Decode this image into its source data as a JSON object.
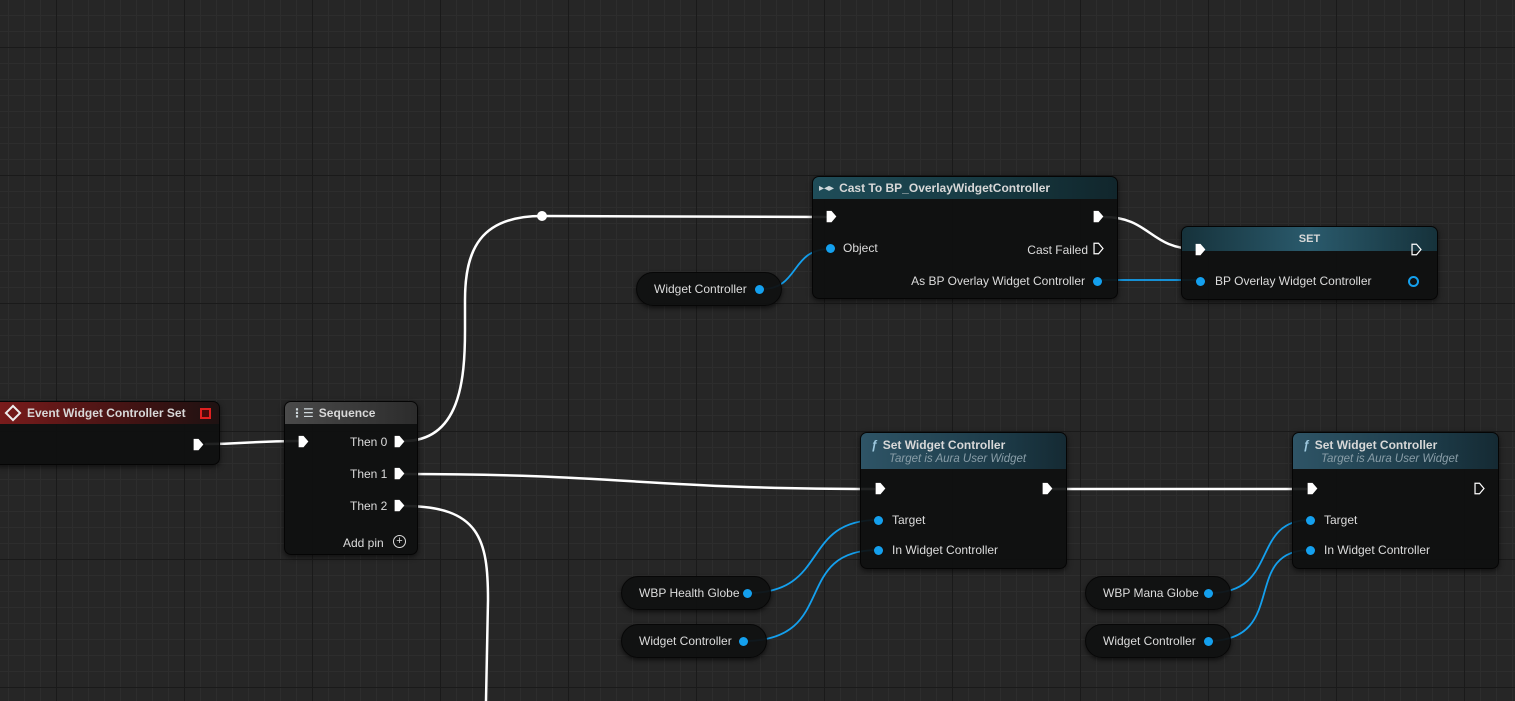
{
  "nodes": {
    "event": {
      "title": "Event Widget Controller Set"
    },
    "sequence": {
      "title": "Sequence",
      "then0": "Then 0",
      "then1": "Then 1",
      "then2": "Then 2",
      "add_pin": "Add pin"
    },
    "cast": {
      "title": "Cast To BP_OverlayWidgetController",
      "object": "Object",
      "cast_failed": "Cast Failed",
      "as_output": "As BP Overlay Widget Controller"
    },
    "set": {
      "title": "SET",
      "input": "BP Overlay Widget Controller"
    },
    "set_wc_1": {
      "title": "Set Widget Controller",
      "subtitle": "Target is Aura User Widget",
      "target": "Target",
      "in_wc": "In Widget Controller"
    },
    "set_wc_2": {
      "title": "Set Widget Controller",
      "subtitle": "Target is Aura User Widget",
      "target": "Target",
      "in_wc": "In Widget Controller"
    }
  },
  "variables": {
    "wc_top": "Widget Controller",
    "health_globe": "WBP Health Globe",
    "wc_mid": "Widget Controller",
    "mana_globe": "WBP Mana Globe",
    "wc_right": "Widget Controller"
  },
  "colors": {
    "exec_wire": "#ffffff",
    "object_pin": "#14a0ee",
    "event_header": "#7c1c1c",
    "pure_header": "#1f4d59",
    "function_header": "#2e5466"
  },
  "icons": {
    "event": "event-diamond-icon",
    "sequence": "sequence-icon",
    "cast": "cast-icon",
    "function": "function-icon",
    "add_pin": "add-pin-plus-icon"
  }
}
